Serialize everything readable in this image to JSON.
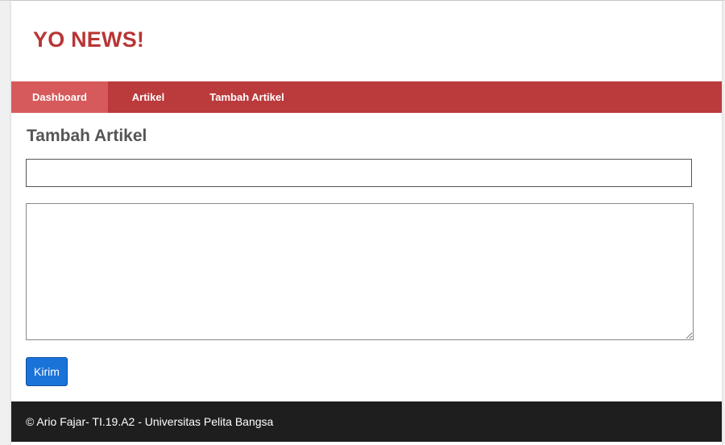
{
  "header": {
    "site_title": "YO NEWS!"
  },
  "nav": {
    "items": [
      {
        "label": "Dashboard",
        "active": true
      },
      {
        "label": "Artikel",
        "active": false
      },
      {
        "label": "Tambah Artikel",
        "active": false
      }
    ]
  },
  "form": {
    "title": "Tambah Artikel",
    "title_input_value": "",
    "body_input_value": "",
    "submit_label": "Kirim"
  },
  "footer": {
    "text": "© Ario Fajar- TI.19.A2 - Universitas Pelita Bangsa"
  },
  "colors": {
    "brand": "#b83535",
    "nav_bg": "#bb3a3c",
    "nav_active": "#d65a5c",
    "button": "#1a73d9",
    "footer_bg": "#1e1e1e"
  }
}
